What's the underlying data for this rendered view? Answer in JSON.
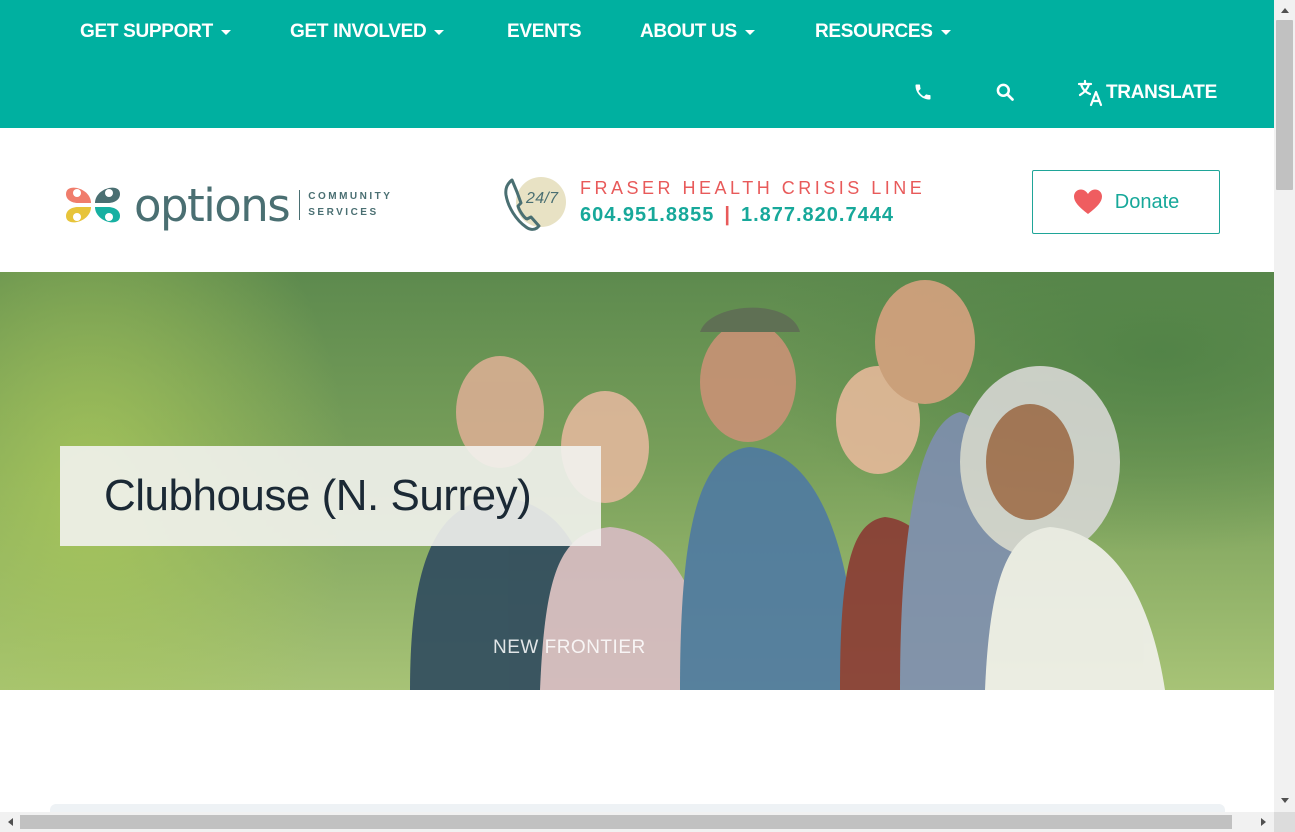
{
  "nav": {
    "items": [
      {
        "label": "GET SUPPORT",
        "has_dropdown": true
      },
      {
        "label": "GET INVOLVED",
        "has_dropdown": true
      },
      {
        "label": "EVENTS",
        "has_dropdown": false
      },
      {
        "label": "ABOUT US",
        "has_dropdown": true
      },
      {
        "label": "RESOURCES",
        "has_dropdown": true
      }
    ],
    "utilities": {
      "phone_icon": "phone-icon",
      "search_icon": "search-icon",
      "translate_icon": "translate-icon",
      "translate_label": "TRANSLATE"
    }
  },
  "header": {
    "logo": {
      "icon": "clover-hearts-logo",
      "wordmark": "options",
      "sub_line_1": "COMMUNITY",
      "sub_line_2": "SERVICES"
    },
    "crisis_line": {
      "badge": "24/7",
      "title": "FRASER HEALTH CRISIS LINE",
      "number_1": "604.951.8855",
      "separator": "|",
      "number_2": "1.877.820.7444"
    },
    "donate": {
      "icon": "heart-icon",
      "label": "Donate"
    }
  },
  "hero": {
    "title": "Clubhouse (N. Surrey)",
    "caption": "NEW FRONTIER"
  },
  "colors": {
    "nav_bg": "#00b0a0",
    "accent_teal": "#17a89a",
    "accent_coral": "#e85a5a",
    "logo_slate": "#4a6f72",
    "title_dark": "#1b2935"
  }
}
